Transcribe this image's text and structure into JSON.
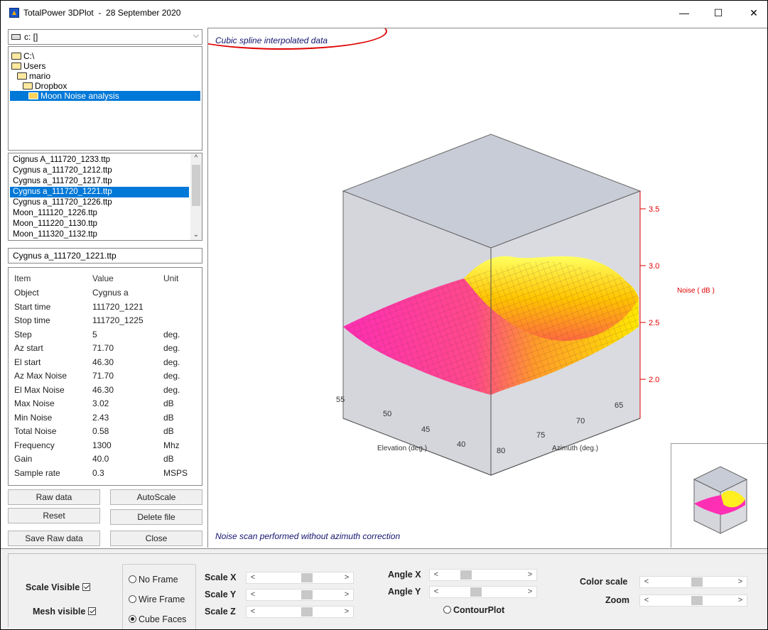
{
  "window": {
    "title": "TotalPower 3DPlot  -  28 September 2020",
    "minimize": "—",
    "maximize": "☐",
    "close": "✕"
  },
  "drive": {
    "label": "c: []",
    "arrow": "⌵"
  },
  "folders": [
    {
      "label": "C:\\",
      "indent": 0,
      "selected": false
    },
    {
      "label": "Users",
      "indent": 0,
      "selected": false
    },
    {
      "label": "mario",
      "indent": 1,
      "selected": false
    },
    {
      "label": "Dropbox",
      "indent": 2,
      "selected": false
    },
    {
      "label": "Moon Noise analysis",
      "indent": 3,
      "selected": true
    }
  ],
  "files": [
    {
      "name": "Cignus A_111720_1233.ttp",
      "selected": false
    },
    {
      "name": "Cygnus a_111720_1212.ttp",
      "selected": false
    },
    {
      "name": "Cygnus a_111720_1217.ttp",
      "selected": false
    },
    {
      "name": "Cygnus a_111720_1221.ttp",
      "selected": true
    },
    {
      "name": "Cygnus a_111720_1226.ttp",
      "selected": false
    },
    {
      "name": "Moon_111120_1226.ttp",
      "selected": false
    },
    {
      "name": "Moon_111220_1130.ttp",
      "selected": false
    },
    {
      "name": "Moon_111320_1132.ttp",
      "selected": false
    }
  ],
  "current_file": "Cygnus a_111720_1221.ttp",
  "info_table": {
    "headers": [
      "Item",
      "Value",
      "Unit"
    ],
    "rows": [
      [
        "Object",
        "Cygnus a",
        ""
      ],
      [
        "Start time",
        "111720_1221",
        ""
      ],
      [
        "Stop time",
        "111720_1225",
        ""
      ],
      [
        "Step",
        "5",
        "deg."
      ],
      [
        "Az start",
        "71.70",
        "deg."
      ],
      [
        "El start",
        "46.30",
        "deg."
      ],
      [
        "Az Max Noise",
        "71.70",
        "deg."
      ],
      [
        "El Max Noise",
        "46.30",
        "deg."
      ],
      [
        "Max Noise",
        "3.02",
        "dB"
      ],
      [
        "Min Noise",
        "2.43",
        "dB"
      ],
      [
        "Total Noise",
        "0.58",
        "dB"
      ],
      [
        "Frequency",
        "1300",
        "Mhz"
      ],
      [
        "Gain",
        "40.0",
        "dB"
      ],
      [
        "Sample rate",
        "0.3",
        "MSPS"
      ]
    ]
  },
  "buttons": {
    "raw_data": "Raw data",
    "autoscale": "AutoScale",
    "reset": "Reset",
    "delete_file": "Delete file",
    "save_raw": "Save Raw data",
    "close": "Close"
  },
  "plot": {
    "top_note": "Cubic spline interpolated data",
    "bottom_note": "Noise scan performed without azimuth correction",
    "z_label": "Noise ( dB )",
    "z_ticks": [
      "3.5",
      "3.0",
      "2.5",
      "2.0"
    ],
    "elevation_label": "Elevation (deg.)",
    "elevation_ticks": [
      "55",
      "50",
      "45",
      "40"
    ],
    "azimuth_label": "Azimuth (deg.)",
    "azimuth_ticks": [
      "80",
      "75",
      "70",
      "65"
    ],
    "axis_color": "#e00000",
    "surface_colors": [
      "#ff2fb4",
      "#ff5c6a",
      "#ffc400",
      "#ffff3a"
    ]
  },
  "controls": {
    "scale_visible": {
      "label": "Scale  Visible",
      "checked": true
    },
    "mesh_visible": {
      "label": "Mesh visible",
      "checked": true
    },
    "frame_options": [
      {
        "label": "No Frame",
        "selected": false
      },
      {
        "label": "Wire Frame",
        "selected": false
      },
      {
        "label": "Cube Faces",
        "selected": true
      }
    ],
    "scale_x": {
      "label": "Scale X",
      "value": 0.6
    },
    "scale_y": {
      "label": "Scale Y",
      "value": 0.6
    },
    "scale_z": {
      "label": "Scale Z",
      "value": 0.6
    },
    "angle_x": {
      "label": "Angle X",
      "value": 0.25
    },
    "angle_y": {
      "label": "Angle Y",
      "value": 0.4
    },
    "contour": {
      "label": "ContourPlot",
      "selected": false
    },
    "color_scale": {
      "label": "Color scale",
      "value": 0.55
    },
    "zoom": {
      "label": "Zoom",
      "value": 0.55
    },
    "arrow_left": "<",
    "arrow_right": ">"
  }
}
